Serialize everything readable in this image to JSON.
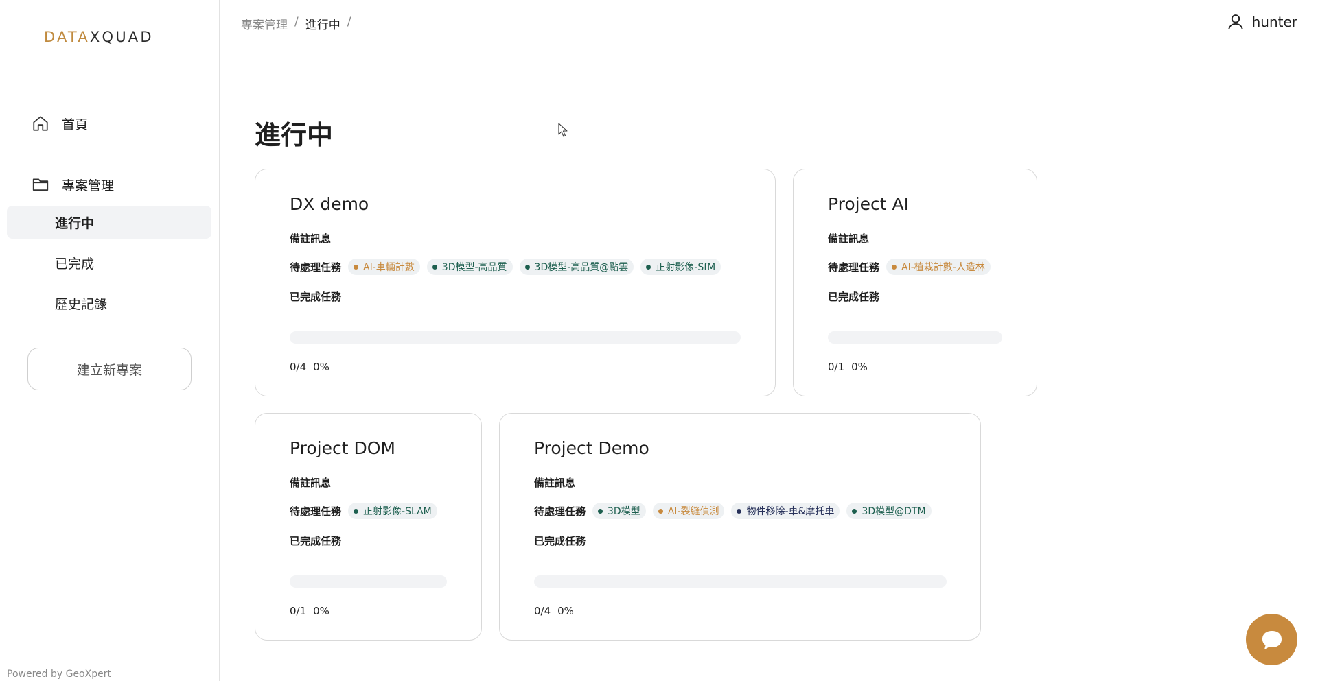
{
  "brand": {
    "logo_part1": "DATA",
    "logo_part2": "XQUAD",
    "accent": "#c08a3e"
  },
  "sidebar": {
    "home_label": "首頁",
    "projects_label": "專案管理",
    "sub_items": [
      "進行中",
      "已完成",
      "歷史記錄"
    ],
    "active_sub": "進行中",
    "new_project_label": "建立新專案",
    "powered_by": "Powered by GeoXpert"
  },
  "topbar": {
    "breadcrumb": [
      "專案管理",
      "進行中"
    ],
    "separator": "/",
    "username": "hunter"
  },
  "page": {
    "title": "進行中"
  },
  "labels": {
    "notes": "備註訊息",
    "pending": "待處理任務",
    "done": "已完成任務"
  },
  "colors": {
    "green": "#1d5f4f",
    "orange": "#c88a3e",
    "navy": "#27315a"
  },
  "projects": [
    {
      "name": "DX demo",
      "tasks": [
        {
          "label": "AI-車輛計數",
          "status": "orange"
        },
        {
          "label": "3D模型-高品質",
          "status": "green"
        },
        {
          "label": "3D模型-高品質@點雲",
          "status": "green"
        },
        {
          "label": "正射影像-SfM",
          "status": "green"
        }
      ],
      "count": "0/4",
      "percent": "0%",
      "progress": 0
    },
    {
      "name": "Project AI",
      "tasks": [
        {
          "label": "AI-植栽計數-人造林",
          "status": "orange"
        }
      ],
      "count": "0/1",
      "percent": "0%",
      "progress": 0
    },
    {
      "name": "Project DOM",
      "tasks": [
        {
          "label": "正射影像-SLAM",
          "status": "green"
        }
      ],
      "count": "0/1",
      "percent": "0%",
      "progress": 0
    },
    {
      "name": "Project Demo",
      "tasks": [
        {
          "label": "3D模型",
          "status": "green"
        },
        {
          "label": "AI-裂縫偵測",
          "status": "orange"
        },
        {
          "label": "物件移除-車&摩托車",
          "status": "navy"
        },
        {
          "label": "3D模型@DTM",
          "status": "green"
        }
      ],
      "count": "0/4",
      "percent": "0%",
      "progress": 0
    }
  ],
  "icons": {
    "home": "home-icon",
    "folder": "folder-icon",
    "user": "user-icon",
    "chat": "chat-icon"
  }
}
